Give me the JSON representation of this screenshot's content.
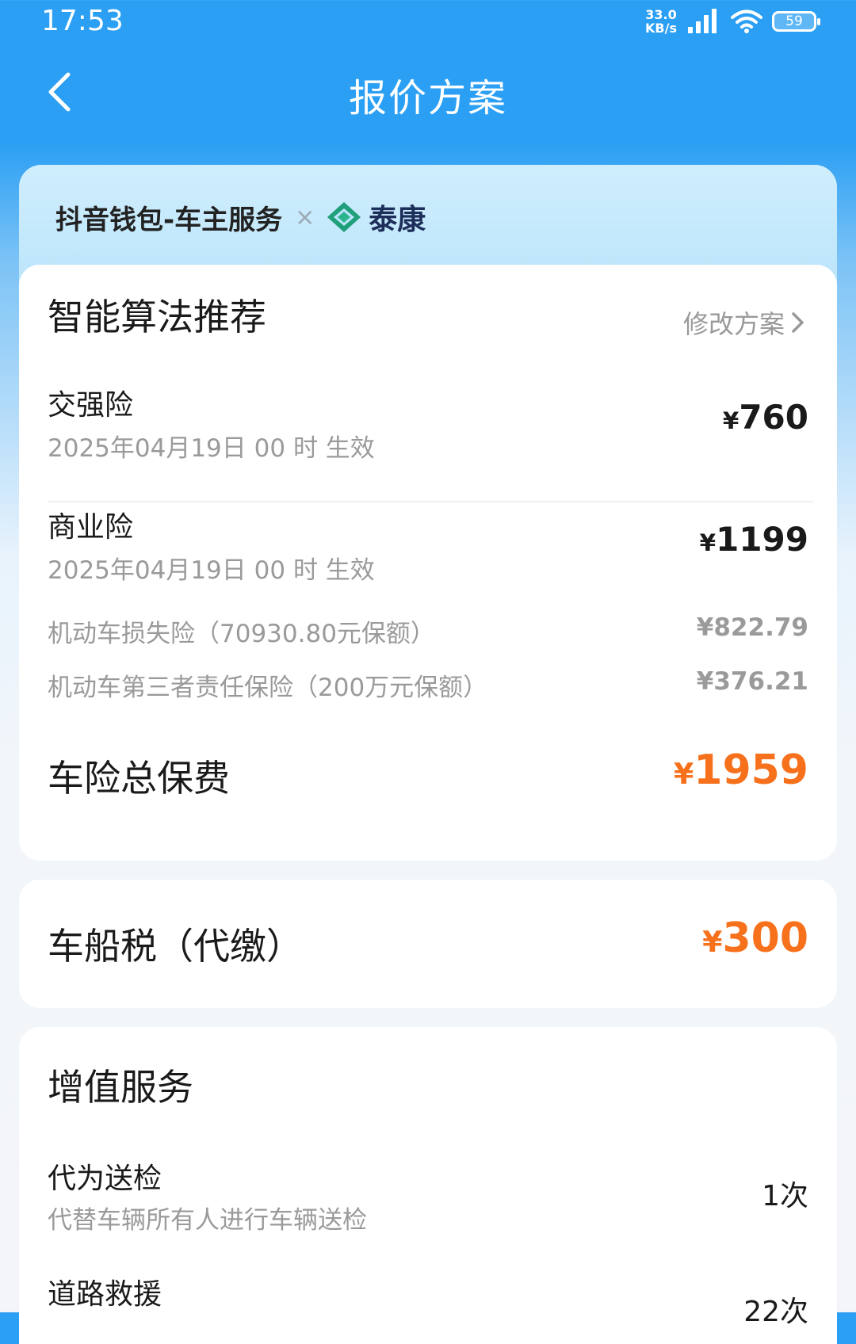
{
  "status_bar": {
    "time": "17:53",
    "net_speed_value": "33.0",
    "net_speed_unit": "KB/s",
    "battery": "59"
  },
  "nav": {
    "title": "报价方案"
  },
  "brand": {
    "partner": "抖音钱包-车主服务",
    "separator": "×",
    "insurer": "泰康"
  },
  "recommendation": {
    "title": "智能算法推荐",
    "edit_label": "修改方案",
    "compulsory": {
      "name": "交强险",
      "effective": "2025年04月19日 00 时 生效",
      "price_symbol": "¥",
      "price": "760"
    },
    "commercial": {
      "name": "商业险",
      "effective": "2025年04月19日 00 时 生效",
      "price_symbol": "¥",
      "price": "1199",
      "items": [
        {
          "label": "机动车损失险（70930.80元保额）",
          "price": "¥822.79"
        },
        {
          "label": "机动车第三者责任保险（200万元保额）",
          "price": "¥376.21"
        }
      ]
    },
    "total": {
      "label": "车险总保费",
      "price_symbol": "¥",
      "price": "1959"
    }
  },
  "tax": {
    "label": "车船税（代缴）",
    "price_symbol": "¥",
    "price": "300"
  },
  "services": {
    "title": "增值服务",
    "items": [
      {
        "name": "代为送检",
        "desc": "代替车辆所有人进行车辆送检",
        "count": "1次"
      },
      {
        "name": "道路救援",
        "count": "22次"
      }
    ]
  },
  "colors": {
    "header_blue": "#2b9ff3",
    "accent_orange": "#f7711c",
    "muted_gray": "#9a9a9a"
  }
}
